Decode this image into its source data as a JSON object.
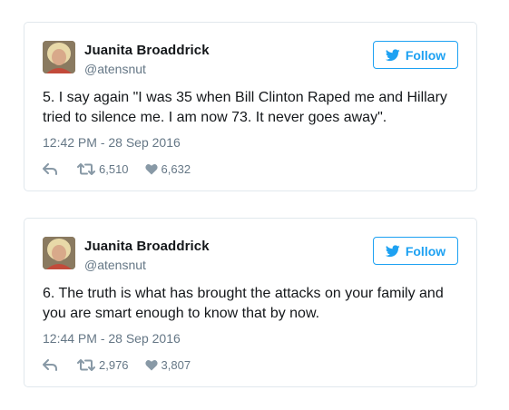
{
  "tweets": [
    {
      "author": "Juanita Broaddrick",
      "handle": "@atensnut",
      "follow_label": "Follow",
      "text": "5. I say again \"I was 35 when Bill Clinton Raped me and Hillary tried to silence me. I am now 73. It never goes away\".",
      "timestamp": "12:42 PM - 28 Sep 2016",
      "retweets": "6,510",
      "likes": "6,632"
    },
    {
      "author": "Juanita Broaddrick",
      "handle": "@atensnut",
      "follow_label": "Follow",
      "text": "6. The truth is what has brought the attacks on your family and you are smart enough to know that by now.",
      "timestamp": "12:44 PM - 28 Sep 2016",
      "retweets": "2,976",
      "likes": "3,807"
    }
  ],
  "icons": {
    "bird": "twitter-bird-icon",
    "reply": "reply-icon",
    "retweet": "retweet-icon",
    "like": "heart-icon"
  },
  "colors": {
    "accent": "#1da1f2",
    "text": "#14171a",
    "muted": "#657786",
    "icon": "#8899a6",
    "border": "#e1e8ed"
  }
}
